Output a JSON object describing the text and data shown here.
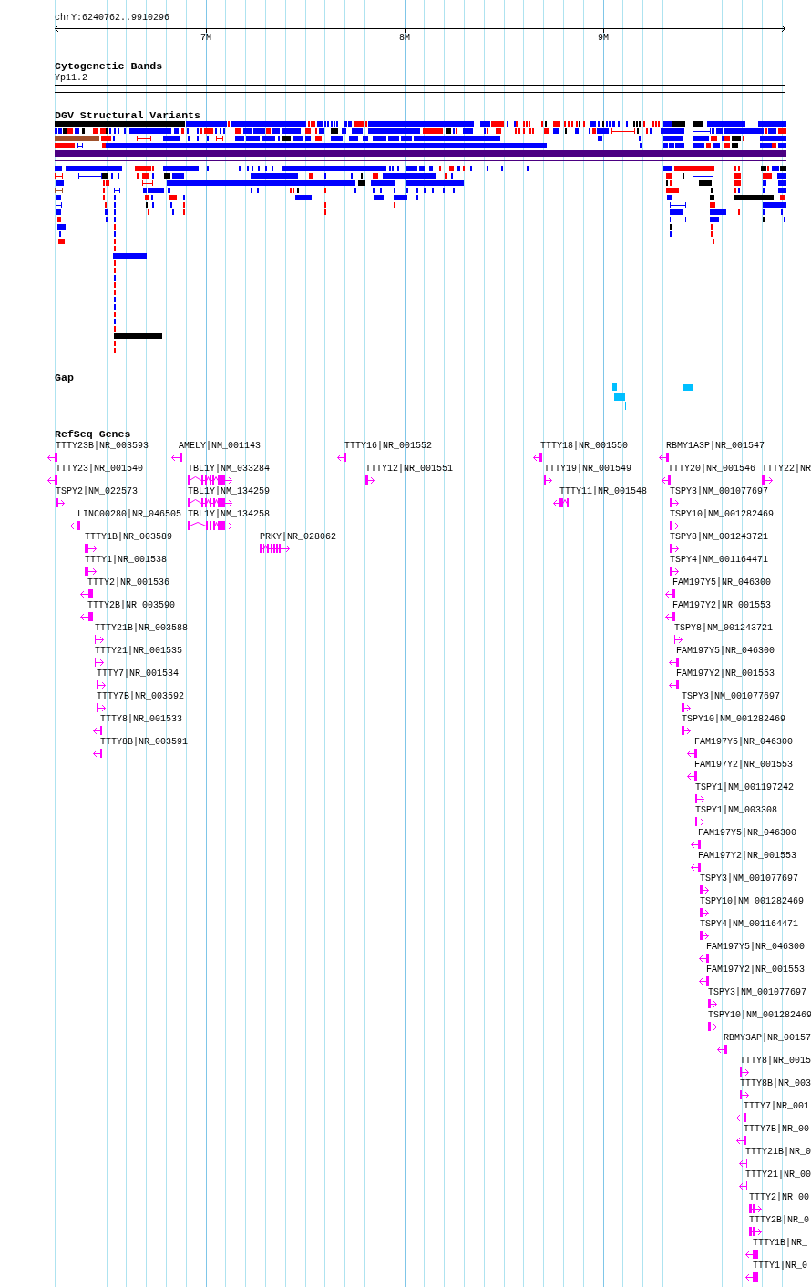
{
  "ruler": {
    "range": "chrY:6240762..9910296",
    "ticks": [
      "7M",
      "8M",
      "9M"
    ]
  },
  "cytogenetic_bands": {
    "title": "Cytogenetic Bands",
    "band": "Yp11.2"
  },
  "dgv_structural_variants": {
    "title": "DGV Structural Variants"
  },
  "gap": {
    "title": "Gap"
  },
  "refseq_genes": {
    "title": "RefSeq Genes",
    "rows": [
      {
        "genes": [
          {
            "label": "TTTY23B|NR_003593",
            "reverse": true
          },
          {
            "label": "AMELY|NM_001143",
            "reverse": true
          },
          {
            "label": "TTTY16|NR_001552",
            "reverse": true
          },
          {
            "label": "TTTY18|NR_001550",
            "reverse": true
          },
          {
            "label": "RBMY1A3P|NR_001547",
            "reverse": true
          }
        ]
      },
      {
        "genes": [
          {
            "label": "TTTY23|NR_001540",
            "reverse": true
          },
          {
            "label": "TBL1Y|NM_033284",
            "reverse": false
          },
          {
            "label": "TTTY12|NR_001551",
            "reverse": false
          },
          {
            "label": "TTTY19|NR_001549",
            "reverse": false
          },
          {
            "label": "TTTY20|NR_001546",
            "reverse": true
          },
          {
            "label": "TTTY22|NR",
            "reverse": false
          }
        ]
      },
      {
        "genes": [
          {
            "label": "TSPY2|NM_022573",
            "reverse": false
          },
          {
            "label": "TBL1Y|NM_134259",
            "reverse": false
          },
          {
            "label": "TTTY11|NR_001548",
            "reverse": true
          },
          {
            "label": "TSPY3|NM_001077697",
            "reverse": false
          }
        ]
      },
      {
        "genes": [
          {
            "label": "LINC00280|NR_046505",
            "reverse": true
          },
          {
            "label": "TBL1Y|NM_134258",
            "reverse": false
          },
          {
            "label": "TSPY10|NM_001282469",
            "reverse": false
          }
        ]
      },
      {
        "genes": [
          {
            "label": "TTTY1B|NR_003589",
            "reverse": false
          },
          {
            "label": "PRKY|NR_028062",
            "reverse": false
          },
          {
            "label": "TSPY8|NM_001243721",
            "reverse": false
          }
        ]
      },
      {
        "genes": [
          {
            "label": "TTTY1|NR_001538",
            "reverse": false
          },
          {
            "label": "TSPY4|NM_001164471",
            "reverse": false
          }
        ]
      },
      {
        "genes": [
          {
            "label": "TTTY2|NR_001536",
            "reverse": true
          },
          {
            "label": "FAM197Y5|NR_046300",
            "reverse": true
          }
        ]
      },
      {
        "genes": [
          {
            "label": "TTTY2B|NR_003590",
            "reverse": true
          },
          {
            "label": "FAM197Y2|NR_001553",
            "reverse": true
          }
        ]
      },
      {
        "genes": [
          {
            "label": "TTTY21B|NR_003588",
            "reverse": false
          },
          {
            "label": "TSPY8|NM_001243721",
            "reverse": false
          }
        ]
      },
      {
        "genes": [
          {
            "label": "TTTY21|NR_001535",
            "reverse": false
          },
          {
            "label": "FAM197Y5|NR_046300",
            "reverse": true
          }
        ]
      },
      {
        "genes": [
          {
            "label": "TTTY7|NR_001534",
            "reverse": false
          },
          {
            "label": "FAM197Y2|NR_001553",
            "reverse": true
          }
        ]
      },
      {
        "genes": [
          {
            "label": "TTTY7B|NR_003592",
            "reverse": false
          },
          {
            "label": "TSPY3|NM_001077697",
            "reverse": false
          }
        ]
      },
      {
        "genes": [
          {
            "label": "TTTY8|NR_001533",
            "reverse": true
          },
          {
            "label": "TSPY10|NM_001282469",
            "reverse": false
          }
        ]
      },
      {
        "genes": [
          {
            "label": "TTTY8B|NR_003591",
            "reverse": true
          },
          {
            "label": "FAM197Y5|NR_046300",
            "reverse": true
          }
        ]
      },
      {
        "genes": [
          {
            "label": "FAM197Y2|NR_001553",
            "reverse": true
          }
        ]
      },
      {
        "genes": [
          {
            "label": "TSPY1|NM_001197242",
            "reverse": false
          }
        ]
      },
      {
        "genes": [
          {
            "label": "TSPY1|NM_003308",
            "reverse": false
          }
        ]
      },
      {
        "genes": [
          {
            "label": "FAM197Y5|NR_046300",
            "reverse": true
          }
        ]
      },
      {
        "genes": [
          {
            "label": "FAM197Y2|NR_001553",
            "reverse": true
          }
        ]
      },
      {
        "genes": [
          {
            "label": "TSPY3|NM_001077697",
            "reverse": false
          }
        ]
      },
      {
        "genes": [
          {
            "label": "TSPY10|NM_001282469",
            "reverse": false
          }
        ]
      },
      {
        "genes": [
          {
            "label": "TSPY4|NM_001164471",
            "reverse": false
          }
        ]
      },
      {
        "genes": [
          {
            "label": "FAM197Y5|NR_046300",
            "reverse": true
          }
        ]
      },
      {
        "genes": [
          {
            "label": "FAM197Y2|NR_001553",
            "reverse": true
          }
        ]
      },
      {
        "genes": [
          {
            "label": "TSPY3|NM_001077697",
            "reverse": false
          }
        ]
      },
      {
        "genes": [
          {
            "label": "TSPY10|NM_001282469",
            "reverse": false
          }
        ]
      },
      {
        "genes": [
          {
            "label": "RBMY3AP|NR_00157",
            "reverse": true
          }
        ]
      },
      {
        "genes": [
          {
            "label": "TTTY8|NR_0015",
            "reverse": false
          }
        ]
      },
      {
        "genes": [
          {
            "label": "TTTY8B|NR_003",
            "reverse": false
          }
        ]
      },
      {
        "genes": [
          {
            "label": "TTTY7|NR_001",
            "reverse": true
          }
        ]
      },
      {
        "genes": [
          {
            "label": "TTTY7B|NR_00",
            "reverse": true
          }
        ]
      },
      {
        "genes": [
          {
            "label": "TTTY21B|NR_0",
            "reverse": true
          }
        ]
      },
      {
        "genes": [
          {
            "label": "TTTY21|NR_00",
            "reverse": true
          }
        ]
      },
      {
        "genes": [
          {
            "label": "TTTY2|NR_00",
            "reverse": false
          }
        ]
      },
      {
        "genes": [
          {
            "label": "TTTY2B|NR_0",
            "reverse": false
          }
        ]
      },
      {
        "genes": [
          {
            "label": "TTTY1B|NR_",
            "reverse": true
          }
        ]
      },
      {
        "genes": [
          {
            "label": "TTTY1|NR_0",
            "reverse": true
          }
        ]
      }
    ]
  }
}
